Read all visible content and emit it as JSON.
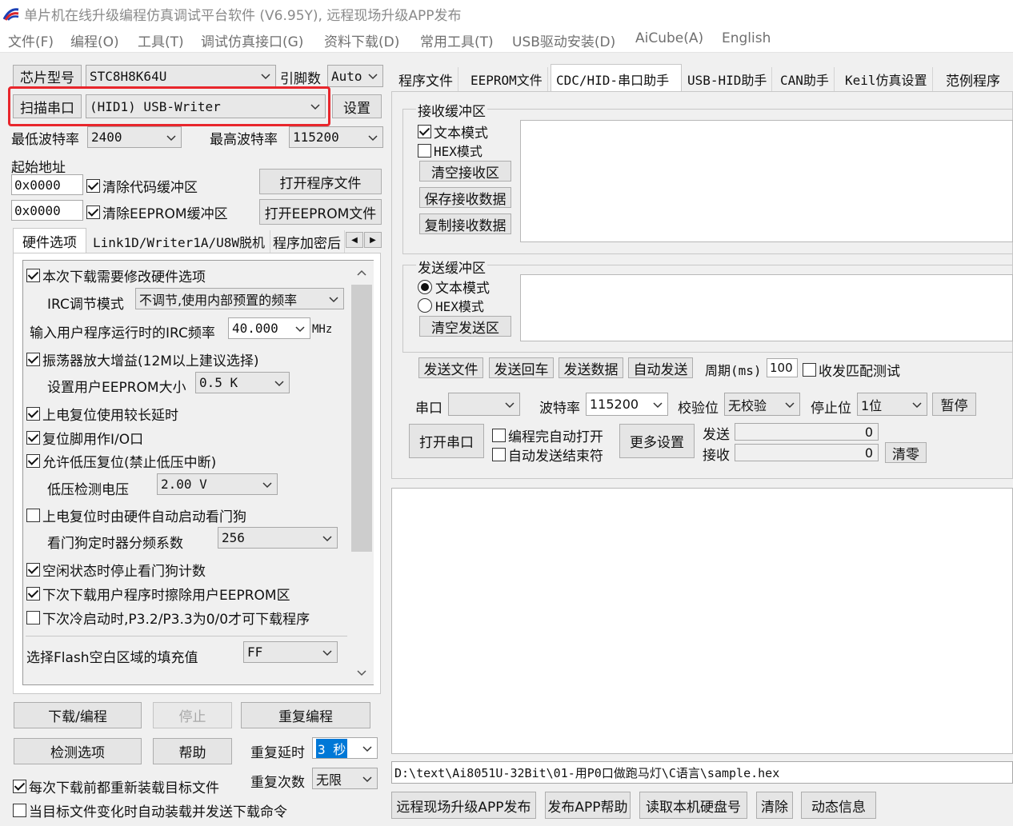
{
  "window": {
    "title": "单片机在线升级编程仿真调试平台软件 (V6.95Y), 远程现场升级APP发布",
    "icon": "stc-app-icon"
  },
  "menu": [
    "文件(F)",
    "编程(O)",
    "工具(T)",
    "调试仿真接口(G)",
    "资料下载(D)",
    "常用工具(T)",
    "USB驱动安装(D)",
    "AiCube(A)",
    "English"
  ],
  "left": {
    "chip_label": "芯片型号",
    "chip_value": "STC8H8K64U",
    "pins_label": "引脚数",
    "pins_value": "Auto",
    "scan_button": "扫描串口",
    "port_value": "(HID1) USB-Writer",
    "settings_button": "设置",
    "min_baud_label": "最低波特率",
    "min_baud_value": "2400",
    "max_baud_label": "最高波特率",
    "max_baud_value": "115200",
    "start_addr_label": "起始地址",
    "addr1": "0x0000",
    "clear_code_label": "清除代码缓冲区",
    "open_program_button": "打开程序文件",
    "addr2": "0x0000",
    "clear_eeprom_label": "清除EEPROM缓冲区",
    "open_eeprom_button": "打开EEPROM文件",
    "tabs": [
      "硬件选项",
      "Link1D/Writer1A/U8W脱机",
      "程序加密后"
    ],
    "options": {
      "modify_hw": "本次下载需要修改硬件选项",
      "irc_mode_label": "IRC调节模式",
      "irc_mode_value": "不调节,使用内部预置的频率",
      "irc_freq_label": "输入用户程序运行时的IRC频率",
      "irc_freq_value": "40.000",
      "irc_freq_unit": "MHz",
      "osc_gain": "振荡器放大增益(12M以上建议选择)",
      "eeprom_size_label": "设置用户EEPROM大小",
      "eeprom_size_value": "0.5 K",
      "long_delay": "上电复位使用较长延时",
      "reset_io": "复位脚用作I/O口",
      "low_volt_reset": "允许低压复位(禁止低压中断)",
      "low_volt_label": "低压检测电压",
      "low_volt_value": "2.00 V",
      "wdt_auto": "上电复位时由硬件自动启动看门狗",
      "wdt_div_label": "看门狗定时器分频系数",
      "wdt_div_value": "256",
      "idle_stop_wdt": "空闲状态时停止看门狗计数",
      "erase_eeprom": "下次下载用户程序时擦除用户EEPROM区",
      "cold_boot": "下次冷启动时,P3.2/P3.3为0/0才可下载程序",
      "flash_fill_label": "选择Flash空白区域的填充值",
      "flash_fill_value": "FF"
    },
    "download_button": "下载/编程",
    "stop_button": "停止",
    "repeat_button": "重复编程",
    "detect_button": "检测选项",
    "help_button": "帮助",
    "repeat_delay_label": "重复延时",
    "repeat_delay_value": "3 秒",
    "repeat_count_label": "重复次数",
    "repeat_count_value": "无限",
    "reload_label": "每次下载前都重新装载目标文件",
    "auto_send_label": "当目标文件变化时自动装载并发送下载命令"
  },
  "right": {
    "tabs": [
      "程序文件",
      "EEPROM文件",
      "CDC/HID-串口助手",
      "USB-HID助手",
      "CAN助手",
      "Keil仿真设置",
      "范例程序"
    ],
    "recv": {
      "legend": "接收缓冲区",
      "text_mode": "文本模式",
      "hex_mode": "HEX模式",
      "clear": "清空接收区",
      "save": "保存接收数据",
      "copy": "复制接收数据"
    },
    "send": {
      "legend": "发送缓冲区",
      "text_mode": "文本模式",
      "hex_mode": "HEX模式",
      "clear": "清空发送区"
    },
    "send_file": "发送文件",
    "send_back": "发送回车",
    "send_data": "发送数据",
    "auto_send": "自动发送",
    "period_label": "周期(ms)",
    "period_value": "100",
    "match_test": "收发匹配测试",
    "port_label": "串口",
    "port_value": "",
    "baud_label": "波特率",
    "baud_value": "115200",
    "parity_label": "校验位",
    "parity_value": "无校验",
    "stop_label": "停止位",
    "stop_value": "1位",
    "pause_button": "暂停",
    "open_port_button": "打开串口",
    "auto_open": "编程完自动打开",
    "auto_end": "自动发送结束符",
    "more_settings": "更多设置",
    "send_count_label": "发送",
    "send_count": "0",
    "recv_count_label": "接收",
    "recv_count": "0",
    "clear_count": "清零",
    "file_path": "D:\\text\\Ai8051U-32Bit\\01-用P0口做跑马灯\\C语言\\sample.hex",
    "bottom_buttons": [
      "远程现场升级APP发布",
      "发布APP帮助",
      "读取本机硬盘号",
      "清除",
      "动态信息"
    ]
  },
  "colors": {
    "highlight_box": "#e8262c",
    "selection": "#0078d7"
  }
}
